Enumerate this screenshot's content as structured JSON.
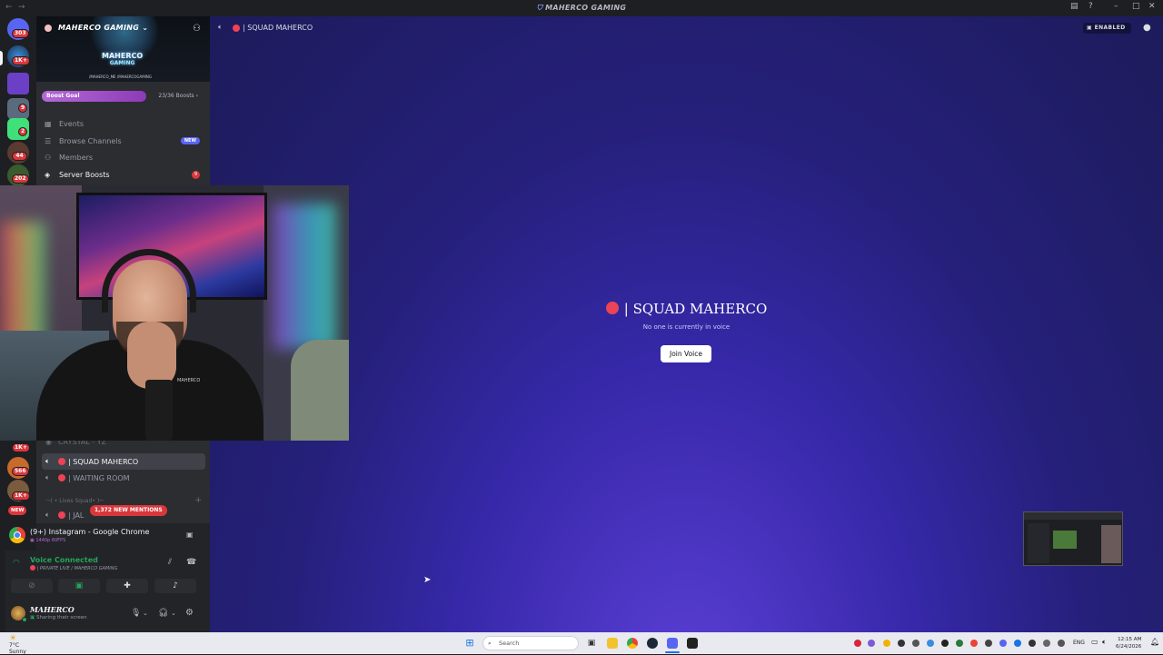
{
  "window": {
    "title": "MAHERCO GAMING"
  },
  "server_rail": {
    "badges": [
      "303",
      "1K+",
      "9",
      "2",
      "44",
      "202",
      "1K+",
      "566",
      "1K+"
    ],
    "new_label": "NEW"
  },
  "server": {
    "name": "MAHERCO GAMING",
    "logo_line1": "MAHERCO",
    "logo_line2": "GAMING",
    "socials": "/MAHERCO_ME  /MAHERCOGAMING",
    "boost_label": "Boost Goal",
    "boost_count": "23/36 Boosts",
    "boost_progress": 0.64
  },
  "menu": {
    "events": "Events",
    "browse": "Browse Channels",
    "browse_badge": "NEW",
    "members": "Members",
    "boosts": "Server Boosts",
    "boosts_badge": "9"
  },
  "channels": {
    "partial_top": "CRYSTAL - YZ",
    "squad": "| SQUAD MAHERCO",
    "waiting": "| WAITING ROOM",
    "category": "·─( • Lives Squad• )─·",
    "partial_bottom": "| JAL",
    "mentions": "1,372 NEW MENTIONS"
  },
  "stream": {
    "title": "(9+) Instagram - Google Chrome",
    "quality": "1440p 60FPS"
  },
  "voice": {
    "status": "Voice Connected",
    "channel": "| PRIVATE LIVE / MAHERCO GAMING"
  },
  "user": {
    "name": "MAHERCO",
    "status": "Sharing their screen"
  },
  "main": {
    "header_channel": "| SQUAD MAHERCO",
    "enabled_label": "ENABLED",
    "title": "| SQUAD MAHERCO",
    "subtitle": "No one is currently in voice",
    "join_label": "Join Voice"
  },
  "webcam": {
    "shirt_logo": "MAHERCO"
  },
  "taskbar": {
    "weather_temp": "7°C",
    "weather_desc": "Sunny",
    "search_placeholder": "Search",
    "lang": "ENG",
    "time": "12:15 AM",
    "date": "6/24/2026"
  },
  "colors": {
    "accent": "#5865f2",
    "live_red": "#ed4356",
    "voice_green": "#23a55a",
    "boost_purple": "#b469d6"
  }
}
